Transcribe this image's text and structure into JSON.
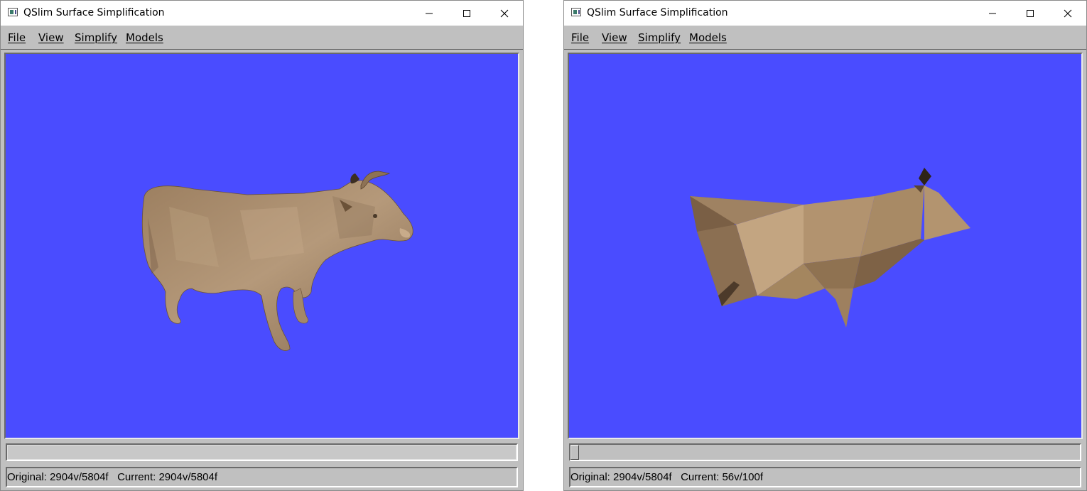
{
  "windows": [
    {
      "title": "QSlim Surface Simplification",
      "menu": [
        "File",
        "View",
        "Simplify",
        "Models"
      ],
      "slider": {
        "level": 1.0
      },
      "status": "Original: 2904v/5804f   Current: 2904v/5804f",
      "model": "cow-high-detail"
    },
    {
      "title": "QSlim Surface Simplification",
      "menu": [
        "File",
        "View",
        "Simplify",
        "Models"
      ],
      "slider": {
        "level": 0.0
      },
      "status": "Original: 2904v/5804f   Current: 56v/100f",
      "model": "cow-low-poly"
    }
  ],
  "colors": {
    "viewport_bg": "#4a4cff",
    "model_tan": "#a58a6a",
    "chrome_gray": "#c0c0c0"
  },
  "icons": {
    "app": "app-icon",
    "minimize": "minimize-icon",
    "maximize": "maximize-icon",
    "close": "close-icon"
  }
}
